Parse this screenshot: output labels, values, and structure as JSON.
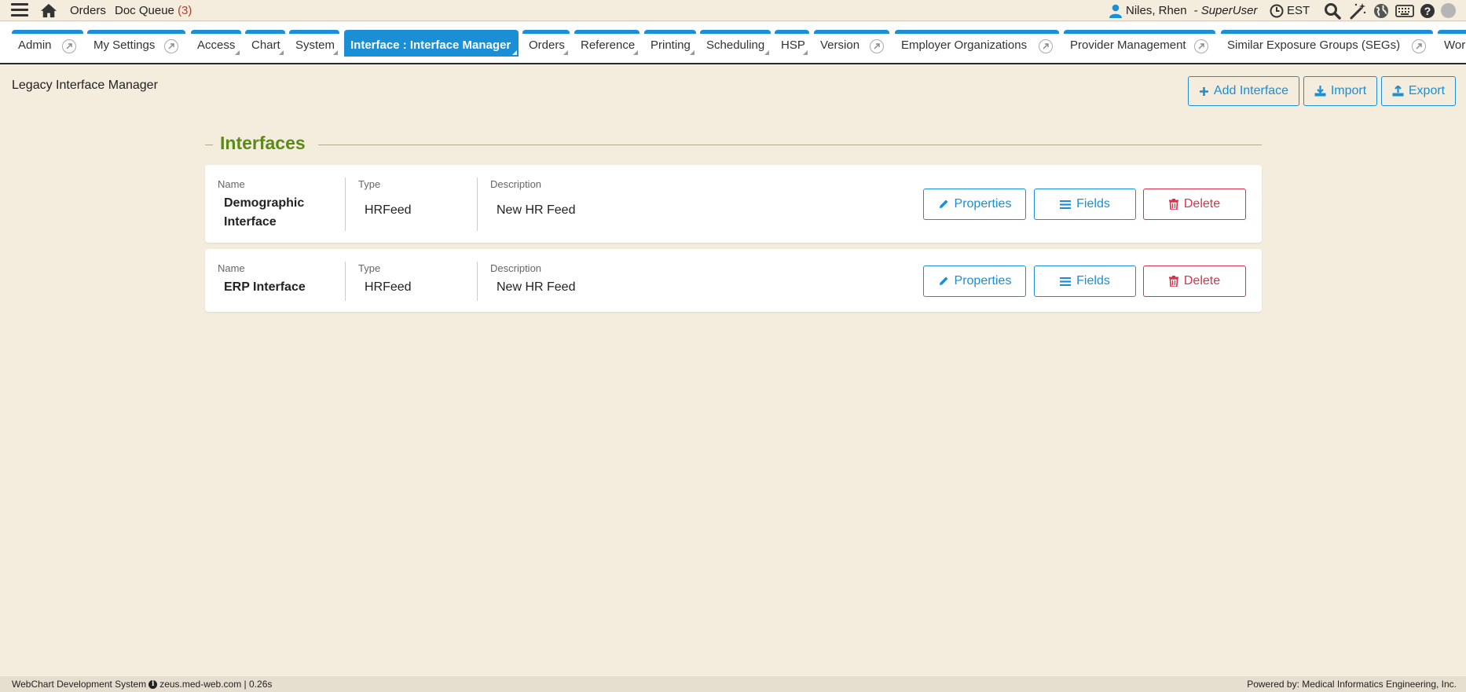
{
  "topbar": {
    "orders_label": "Orders",
    "doc_queue_label": "Doc Queue",
    "doc_queue_count": "(3)",
    "user_name": "Niles, Rhen",
    "user_role": "- SuperUser",
    "timezone": "EST",
    "icons": [
      "menu-icon",
      "home-icon",
      "user-icon",
      "clock-icon",
      "search-icon",
      "magic-wand-icon",
      "globe-icon",
      "keyboard-icon",
      "help-icon",
      "status-dot-icon"
    ]
  },
  "tabs": [
    {
      "label": "Admin"
    },
    {
      "label": "My Settings"
    },
    {
      "label": "Access"
    },
    {
      "label": "Chart"
    },
    {
      "label": "System"
    },
    {
      "label": "Interface : Interface Manager",
      "active": true
    },
    {
      "label": "Orders"
    },
    {
      "label": "Reference"
    },
    {
      "label": "Printing"
    },
    {
      "label": "Scheduling"
    },
    {
      "label": "HSP"
    },
    {
      "label": "Version"
    },
    {
      "label": "Employer Organizations"
    },
    {
      "label": "Provider Management"
    },
    {
      "label": "Similar Exposure Groups (SEGs)"
    },
    {
      "label": "Worl"
    }
  ],
  "page": {
    "title": "Legacy Interface Manager",
    "add_interface_label": "Add Interface",
    "import_label": "Import",
    "export_label": "Export"
  },
  "section": {
    "title": "Interfaces",
    "name_header": "Name",
    "type_header": "Type",
    "description_header": "Description",
    "properties_label": "Properties",
    "fields_label": "Fields",
    "delete_label": "Delete"
  },
  "interfaces": [
    {
      "name_line1": "Demographic",
      "name_line2": "Interface",
      "type": "HRFeed",
      "description": "New HR Feed"
    },
    {
      "name_line1": "ERP Interface",
      "name_line2": "",
      "type": "HRFeed",
      "description": "New HR Feed"
    }
  ],
  "footer": {
    "system": "WebChart Development System",
    "host": "zeus.med-web.com | 0.26s",
    "powered_by": "Powered by: Medical Informatics Engineering, Inc."
  },
  "colors": {
    "background": "#f4ecdc",
    "accent": "#1a8fd6",
    "section_title": "#5a8a1a",
    "danger": "#d9324a",
    "badge_count": "#c0392b"
  }
}
